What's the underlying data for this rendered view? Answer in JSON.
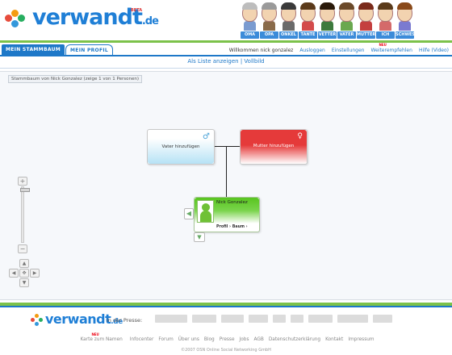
{
  "header": {
    "logo_text": "verwandt",
    "logo_tld": ".de",
    "beta_badge": "BETA",
    "avatars": [
      {
        "label": "OMA",
        "hair": "#bdbdbd",
        "body": "#7a9bd0"
      },
      {
        "label": "OPA",
        "hair": "#9a9a9a",
        "body": "#8a6b4a"
      },
      {
        "label": "ONKEL",
        "hair": "#3a3a3a",
        "body": "#6a6a6a"
      },
      {
        "label": "TANTE",
        "hair": "#5b3a1a",
        "body": "#d34b4b"
      },
      {
        "label": "VETTER",
        "hair": "#2a1a0a",
        "body": "#3d7a3d"
      },
      {
        "label": "VATER",
        "hair": "#6b4a2a",
        "body": "#6aa84f"
      },
      {
        "label": "MUTTER",
        "hair": "#7a2a1a",
        "body": "#c43f3f"
      },
      {
        "label": "ICH",
        "hair": "#5a3a1a",
        "body": "#d46a6a"
      },
      {
        "label": "SCHWESTER",
        "hair": "#8a4a1a",
        "body": "#7a7ad0"
      }
    ]
  },
  "tabs": [
    {
      "label": "MEIN STAMMBAUM",
      "active": true
    },
    {
      "label": "MEIN PROFIL",
      "active": false
    }
  ],
  "topnav": {
    "welcome": "Willkommen nick gonzalez",
    "links": [
      "Ausloggen",
      "Einstellungen",
      "Weiterempfehlen",
      "Hilfe (Video)"
    ],
    "neu_badge": "NEU"
  },
  "sub_actions": {
    "list": "Als Liste anzeigen",
    "separator": "|",
    "fullscreen": "Vollbild"
  },
  "canvas": {
    "label": "Stammbaum von Nick Gonzalez (zeige 1 von 1 Personen)",
    "father_card": {
      "label": "Vater hinzufügen",
      "symbol": "♂"
    },
    "mother_card": {
      "label": "Mutter hinzufügen",
      "symbol": "♀"
    },
    "self_card": {
      "name": "Nick Gonzalez",
      "links": "Profil  › Baum  ›"
    }
  },
  "footer": {
    "logo_text": "verwandt",
    "logo_tld": ".de",
    "presse_label": "in der Presse:",
    "press_logos": [
      "",
      "",
      "",
      "",
      "",
      "",
      "",
      "",
      ""
    ],
    "links": [
      "Karte zum Namen",
      "Infocenter",
      "Forum",
      "Über uns",
      "Blog",
      "Presse",
      "Jobs",
      "AGB",
      "Datenschutzerklärung",
      "Kontakt",
      "Impressum"
    ],
    "neu_badge": "NEU",
    "copyright": "©2007 OSN Online Social Networking GmbH"
  }
}
